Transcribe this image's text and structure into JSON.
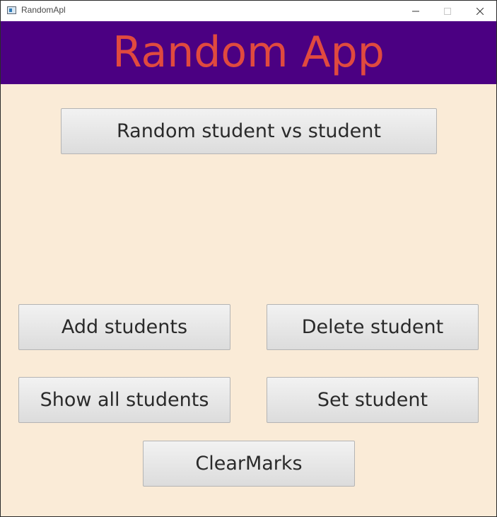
{
  "window": {
    "title": "RandomApl",
    "icon": "app-window-icon"
  },
  "header": {
    "title": "Random App",
    "background": "#4b0082",
    "title_color": "#e04a3f"
  },
  "content": {
    "background": "#faebd7"
  },
  "buttons": {
    "random_vs": "Random student vs student",
    "add_students": "Add students",
    "delete_student": "Delete student",
    "show_all": "Show all students",
    "set_student": "Set student",
    "clear_marks": "ClearMarks"
  }
}
